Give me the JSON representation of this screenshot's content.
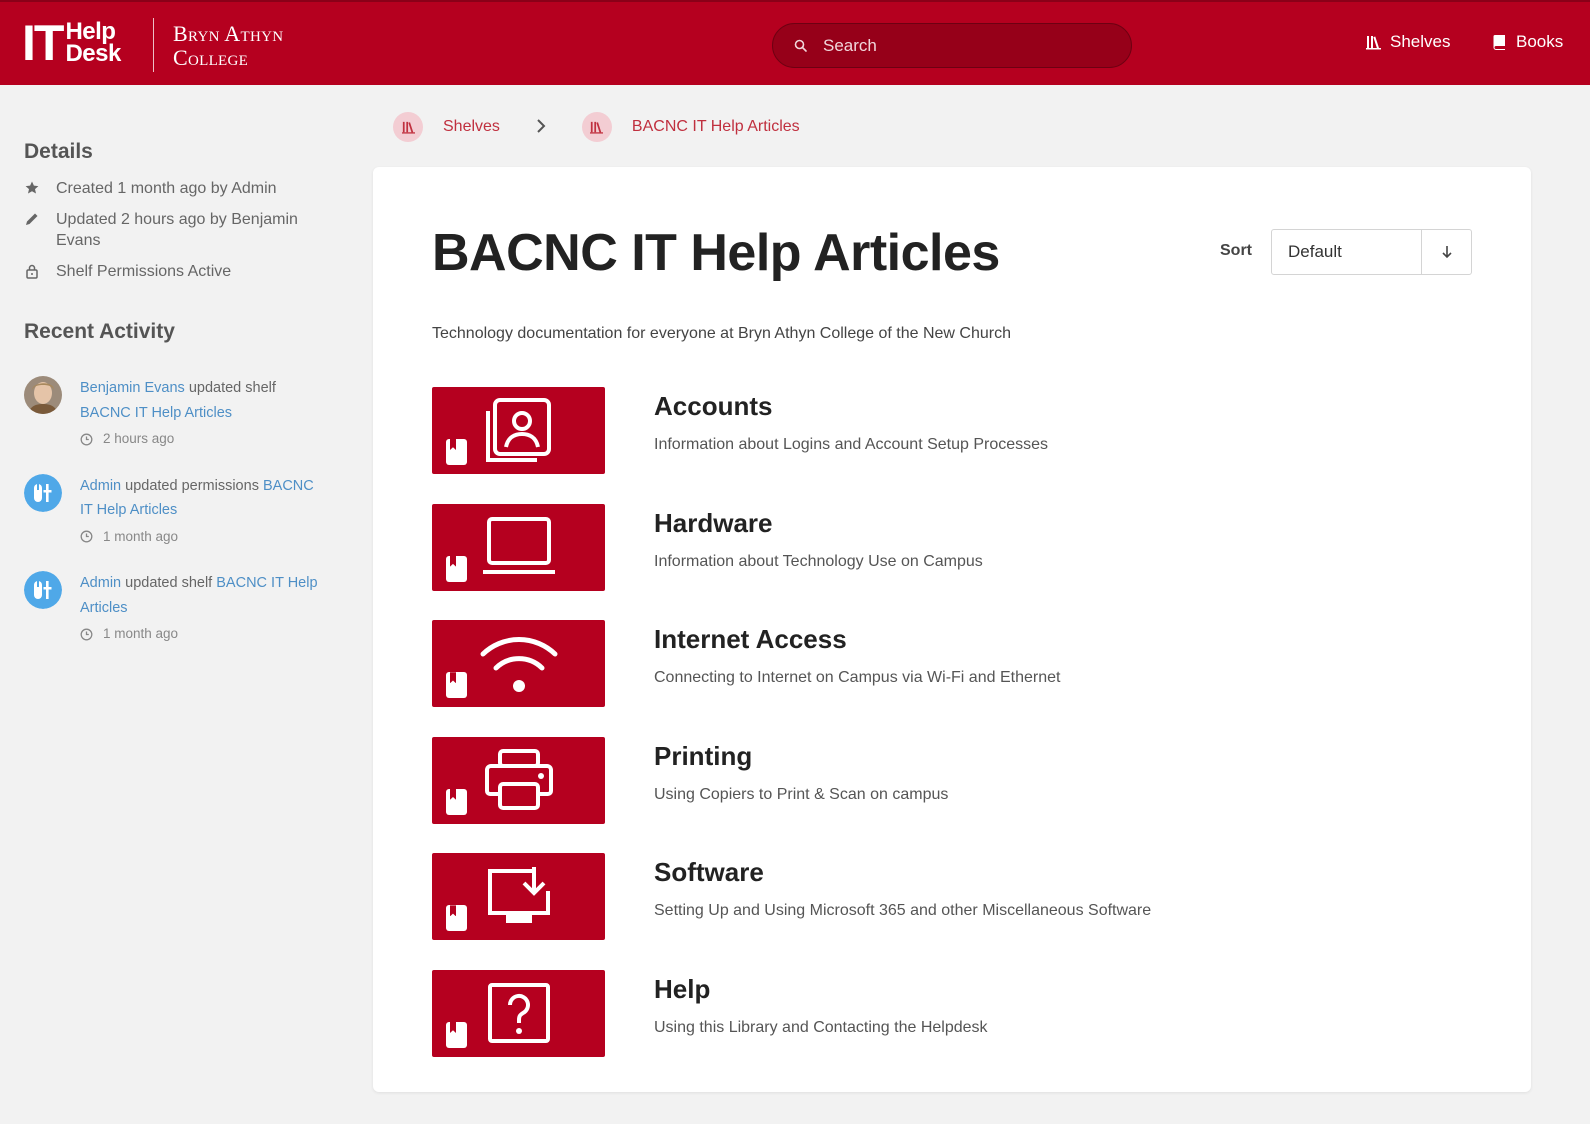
{
  "header": {
    "logo_it": "IT",
    "logo_help": "Help",
    "logo_desk": "Desk",
    "college_line1": "Bryn Athyn",
    "college_line2": "College",
    "search_placeholder": "Search",
    "nav": [
      {
        "label": "Shelves",
        "icon": "shelves-icon"
      },
      {
        "label": "Books",
        "icon": "books-icon"
      }
    ],
    "brand_color": "#b5001f"
  },
  "sidebar": {
    "details_heading": "Details",
    "details": [
      {
        "icon": "star-icon",
        "text": "Created 1 month ago by Admin"
      },
      {
        "icon": "pencil-icon",
        "text": "Updated 2 hours ago by Benjamin Evans"
      },
      {
        "icon": "lock-icon",
        "text": "Shelf Permissions Active"
      }
    ],
    "activity_heading": "Recent Activity",
    "activity": [
      {
        "user": "Benjamin Evans",
        "action": "updated shelf",
        "target": "BACNC IT Help Articles",
        "time": "2 hours ago",
        "avatar": "photo"
      },
      {
        "user": "Admin",
        "action": "updated permissions",
        "target": "BACNC IT Help Articles",
        "time": "1 month ago",
        "avatar": "admin-icon"
      },
      {
        "user": "Admin",
        "action": "updated shelf",
        "target": "BACNC IT Help Articles",
        "time": "1 month ago",
        "avatar": "admin-icon"
      }
    ]
  },
  "breadcrumb": {
    "items": [
      "Shelves",
      "BACNC IT Help Articles"
    ]
  },
  "main": {
    "title": "BACNC IT Help Articles",
    "sort_label": "Sort",
    "sort_value": "Default",
    "description": "Technology documentation for everyone at Bryn Athyn College of the New Church",
    "books": [
      {
        "title": "Accounts",
        "description": "Information about Logins and Account Setup Processes",
        "icon": "account-portrait-icon"
      },
      {
        "title": "Hardware",
        "description": "Information about Technology Use on Campus",
        "icon": "laptop-icon"
      },
      {
        "title": "Internet Access",
        "description": "Connecting to Internet on Campus via Wi-Fi and Ethernet",
        "icon": "wifi-icon"
      },
      {
        "title": "Printing",
        "description": "Using Copiers to Print & Scan on campus",
        "icon": "printer-icon"
      },
      {
        "title": "Software",
        "description": "Setting Up and Using Microsoft 365 and other Miscellaneous Software",
        "icon": "monitor-download-icon"
      },
      {
        "title": "Help",
        "description": "Using this Library and Contacting the Helpdesk",
        "icon": "question-icon"
      }
    ]
  }
}
